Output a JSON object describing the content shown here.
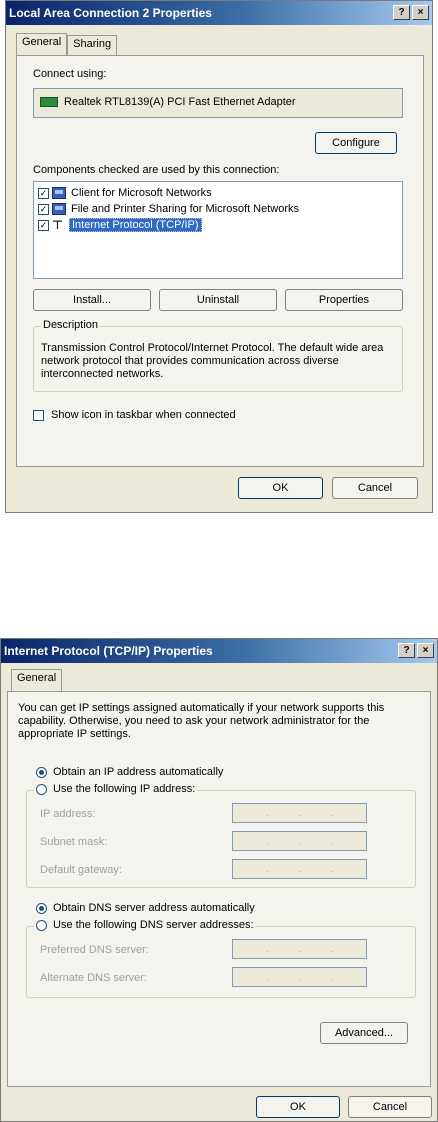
{
  "dialog1": {
    "title": "Local Area Connection 2 Properties",
    "help_btn": "?",
    "close_btn": "×",
    "tabs": [
      "General",
      "Sharing"
    ],
    "connect_using_label": "Connect using:",
    "adapter_name": "Realtek RTL8139(A) PCI Fast Ethernet Adapter",
    "configure_label": "Configure",
    "components_label": "Components checked are used by this connection:",
    "components": [
      {
        "label": "Client for Microsoft Networks",
        "checked": true,
        "icon": "network-client-icon"
      },
      {
        "label": "File and Printer Sharing for Microsoft Networks",
        "checked": true,
        "icon": "file-printer-sharing-icon"
      },
      {
        "label": "Internet Protocol (TCP/IP)",
        "checked": true,
        "icon": "protocol-icon",
        "selected": true
      }
    ],
    "install_label": "Install...",
    "uninstall_label": "Uninstall",
    "properties_label": "Properties",
    "description_legend": "Description",
    "description_text": "Transmission Control Protocol/Internet Protocol. The default wide area network protocol that provides communication across diverse interconnected networks.",
    "show_icon_label": "Show icon in taskbar when connected",
    "ok_label": "OK",
    "cancel_label": "Cancel"
  },
  "dialog2": {
    "title": "Internet Protocol (TCP/IP) Properties",
    "help_btn": "?",
    "close_btn": "×",
    "tabs": [
      "General"
    ],
    "intro_text": "You can get IP settings assigned automatically if your network supports this capability. Otherwise, you need to ask your network administrator for the appropriate IP settings.",
    "obtain_ip_auto": "Obtain an IP address automatically",
    "use_following_ip": "Use the following IP address:",
    "ip_address_label": "IP address:",
    "subnet_mask_label": "Subnet mask:",
    "default_gateway_label": "Default gateway:",
    "obtain_dns_auto": "Obtain DNS server address automatically",
    "use_following_dns": "Use the following DNS server addresses:",
    "preferred_dns_label": "Preferred DNS server:",
    "alternate_dns_label": "Alternate DNS server:",
    "ip_dots": ".",
    "advanced_label": "Advanced...",
    "ok_label": "OK",
    "cancel_label": "Cancel"
  }
}
